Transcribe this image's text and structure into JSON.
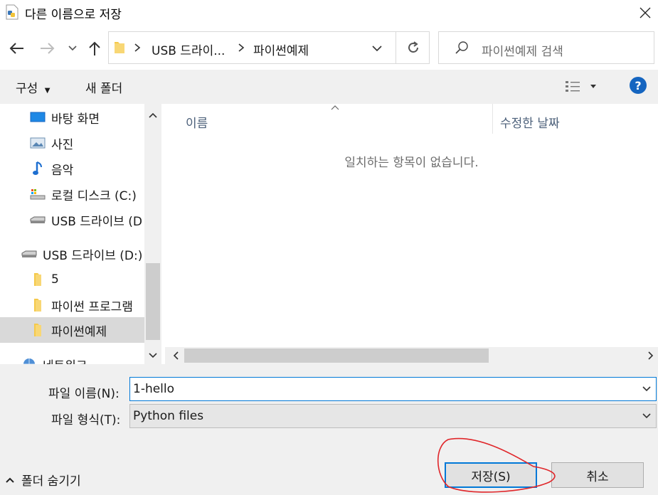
{
  "window": {
    "title": "다른 이름으로 저장"
  },
  "address": {
    "crumbs": [
      "USB 드라이...",
      "파이썬예제"
    ]
  },
  "search": {
    "placeholder": "파이썬예제 검색"
  },
  "toolbar": {
    "organize": "구성",
    "new_folder": "새 폴더",
    "help": "?"
  },
  "nav": {
    "items": [
      {
        "label": "바탕 화면",
        "icon": "desktop-icon"
      },
      {
        "label": "사진",
        "icon": "pictures-icon"
      },
      {
        "label": "음악",
        "icon": "music-icon"
      },
      {
        "label": "로컬 디스크 (C:)",
        "icon": "local-disk-icon"
      },
      {
        "label": "USB 드라이브 (D",
        "icon": "usb-drive-icon"
      },
      {
        "label": "USB 드라이브 (D:)",
        "icon": "usb-drive-icon"
      },
      {
        "label": "5",
        "icon": "folder-icon"
      },
      {
        "label": "파이썬 프로그램",
        "icon": "folder-icon"
      },
      {
        "label": "파이썬예제",
        "icon": "folder-icon",
        "selected": true
      },
      {
        "label": "네트워크",
        "icon": "network-icon"
      }
    ]
  },
  "file_list": {
    "columns": [
      "이름",
      "수정한 날짜"
    ],
    "empty_message": "일치하는 항목이 없습니다."
  },
  "form": {
    "filename_label": "파일 이름(N):",
    "filename_value": "1-hello",
    "filetype_label": "파일 형식(T):",
    "filetype_value": "Python files"
  },
  "footer": {
    "hide_folders": "폴더 숨기기",
    "save": "저장(S)",
    "cancel": "취소"
  },
  "colors": {
    "accent": "#0078d7",
    "help": "#1565c0",
    "annotation": "#e0262a",
    "folder": "#f5c94a"
  }
}
